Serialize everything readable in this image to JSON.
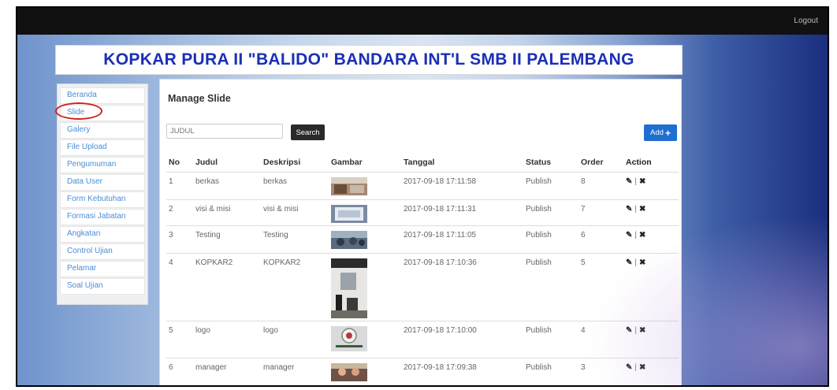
{
  "topbar": {
    "logout_label": "Logout"
  },
  "header": {
    "title": "KOPKAR PURA II \"BALIDO\" BANDARA INT'L SMB II PALEMBANG"
  },
  "sidebar": {
    "items": [
      {
        "label": "Beranda"
      },
      {
        "label": "Slide"
      },
      {
        "label": "Galery"
      },
      {
        "label": "File Upload"
      },
      {
        "label": "Pengumuman"
      },
      {
        "label": "Data User"
      },
      {
        "label": "Form Kebutuhan"
      },
      {
        "label": "Formasi Jabatan"
      },
      {
        "label": "Angkatan"
      },
      {
        "label": "Control Ujian"
      },
      {
        "label": "Pelamar"
      },
      {
        "label": "Soal Ujian"
      }
    ]
  },
  "main": {
    "title": "Manage Slide",
    "search": {
      "placeholder": "JUDUL",
      "button_label": "Search"
    },
    "add_label": "Add",
    "columns": [
      "No",
      "Judul",
      "Deskripsi",
      "Gambar",
      "Tanggal",
      "Status",
      "Order",
      "Action"
    ],
    "rows": [
      {
        "no": "1",
        "judul": "berkas",
        "deskripsi": "berkas",
        "gambar_icon": "photo-thumbnail-icon",
        "tanggal": "2017-09-18 17:11:58",
        "status": "Publish",
        "order": "8"
      },
      {
        "no": "2",
        "judul": "visi & misi",
        "deskripsi": "visi & misi",
        "gambar_icon": "photo-thumbnail-icon",
        "tanggal": "2017-09-18 17:11:31",
        "status": "Publish",
        "order": "7"
      },
      {
        "no": "3",
        "judul": "Testing",
        "deskripsi": "Testing",
        "gambar_icon": "photo-thumbnail-icon",
        "tanggal": "2017-09-18 17:11:05",
        "status": "Publish",
        "order": "6"
      },
      {
        "no": "4",
        "judul": "KOPKAR2",
        "deskripsi": "KOPKAR2",
        "gambar_icon": "photo-thumbnail-icon",
        "tanggal": "2017-09-18 17:10:36",
        "status": "Publish",
        "order": "5"
      },
      {
        "no": "5",
        "judul": "logo",
        "deskripsi": "logo",
        "gambar_icon": "logo-thumbnail-icon",
        "tanggal": "2017-09-18 17:10:00",
        "status": "Publish",
        "order": "4"
      },
      {
        "no": "6",
        "judul": "manager",
        "deskripsi": "manager",
        "gambar_icon": "photo-thumbnail-icon",
        "tanggal": "2017-09-18 17:09:38",
        "status": "Publish",
        "order": "3"
      }
    ],
    "action_separator": "|"
  },
  "colors": {
    "title_blue": "#1a2fb5",
    "link_blue": "#4a8ed6",
    "add_button": "#1f6fd0",
    "highlight_circle": "#d0201e",
    "topbar": "#111111"
  }
}
